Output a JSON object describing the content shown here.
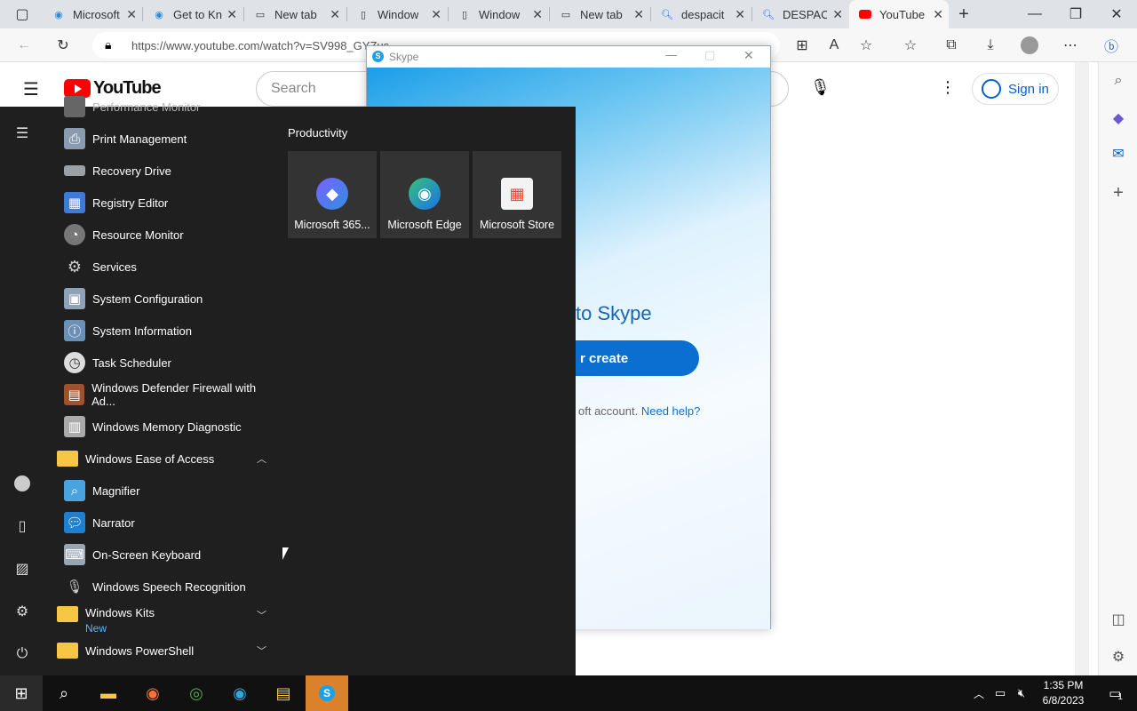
{
  "browser": {
    "tabs": [
      {
        "title": "Microsoft",
        "icon": "edge-icon"
      },
      {
        "title": "Get to Kn",
        "icon": "edge-icon"
      },
      {
        "title": "New tab",
        "icon": "newtab-icon"
      },
      {
        "title": "Window",
        "icon": "page-icon"
      },
      {
        "title": "Window",
        "icon": "page-icon"
      },
      {
        "title": "New tab",
        "icon": "newtab-icon"
      },
      {
        "title": "despacit",
        "icon": "search-icon"
      },
      {
        "title": "DESPACI",
        "icon": "search-icon"
      },
      {
        "title": "YouTube",
        "icon": "youtube-icon"
      }
    ],
    "url": "https://www.youtube.com/watch?v=SV998_GYZus"
  },
  "youtube": {
    "logo_text": "YouTube",
    "search_placeholder": "Search",
    "signin_label": "Sign in"
  },
  "skype": {
    "title": "Skype",
    "welcome": "to Skype",
    "button_label": "r create",
    "account_text": "oft account.",
    "help_link": "Need help?"
  },
  "start_menu": {
    "partial_top": "Performance Monitor",
    "apps": [
      {
        "label": "Print Management",
        "icon": "printer-icon"
      },
      {
        "label": "Recovery Drive",
        "icon": "drive-icon"
      },
      {
        "label": "Registry Editor",
        "icon": "registry-icon"
      },
      {
        "label": "Resource Monitor",
        "icon": "monitor-gauge-icon"
      },
      {
        "label": "Services",
        "icon": "gear-icon"
      },
      {
        "label": "System Configuration",
        "icon": "syscfg-icon"
      },
      {
        "label": "System Information",
        "icon": "info-icon"
      },
      {
        "label": "Task Scheduler",
        "icon": "clock-icon"
      },
      {
        "label": "Windows Defender Firewall with Ad...",
        "icon": "firewall-icon"
      },
      {
        "label": "Windows Memory Diagnostic",
        "icon": "memory-icon"
      }
    ],
    "folder_ease": "Windows Ease of Access",
    "ease_apps": [
      {
        "label": "Magnifier",
        "icon": "magnifier-icon"
      },
      {
        "label": "Narrator",
        "icon": "narrator-icon"
      },
      {
        "label": "On-Screen Keyboard",
        "icon": "keyboard-icon"
      },
      {
        "label": "Windows Speech Recognition",
        "icon": "microphone-icon"
      }
    ],
    "folder_kits": "Windows Kits",
    "kits_badge": "New",
    "folder_powershell": "Windows PowerShell",
    "group_title": "Productivity",
    "tiles": [
      {
        "label": "Microsoft 365...",
        "icon": "m365-icon"
      },
      {
        "label": "Microsoft Edge",
        "icon": "edge-icon"
      },
      {
        "label": "Microsoft Store",
        "icon": "store-icon"
      }
    ]
  },
  "taskbar": {
    "time": "1:35 PM",
    "date": "6/8/2023",
    "notification_count": "1"
  }
}
